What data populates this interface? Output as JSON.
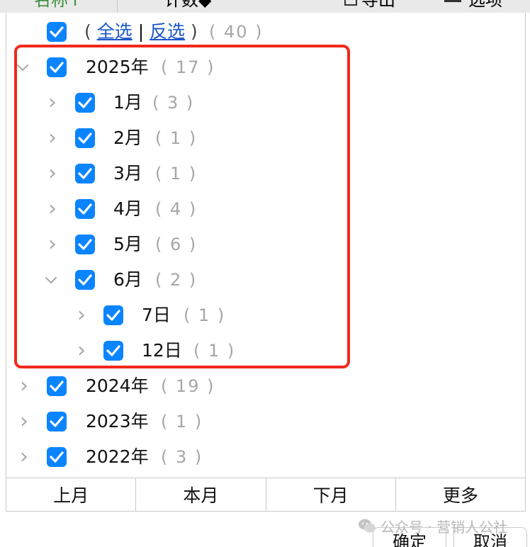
{
  "header": {
    "col_name": "名称↑",
    "col_count": "计数◆",
    "export": "导出",
    "options": "选项"
  },
  "tree": {
    "select_all_open": "(",
    "select_all": "全选",
    "divider": "|",
    "invert": "反选",
    "select_all_close": ")",
    "total_count": "( 40 )",
    "year_2025": {
      "label": "2025年",
      "count": "( 17 )"
    },
    "months": [
      {
        "label": "1月",
        "count": "( 3 )"
      },
      {
        "label": "2月",
        "count": "( 1 )"
      },
      {
        "label": "3月",
        "count": "( 1 )"
      },
      {
        "label": "4月",
        "count": "( 4 )"
      },
      {
        "label": "5月",
        "count": "( 6 )"
      },
      {
        "label": "6月",
        "count": "( 2 )"
      }
    ],
    "days": [
      {
        "label": "7日",
        "count": "( 1 )"
      },
      {
        "label": "12日",
        "count": "( 1 )"
      }
    ],
    "year_2024": {
      "label": "2024年",
      "count": "( 19 )"
    },
    "year_2023": {
      "label": "2023年",
      "count": "( 1 )"
    },
    "year_2022": {
      "label": "2022年",
      "count": "( 3 )"
    }
  },
  "buttons": {
    "last_month": "上月",
    "this_month": "本月",
    "next_month": "下月",
    "more": "更多"
  },
  "footer": {
    "ok": "确定",
    "cancel": "取消"
  },
  "watermark": "公众号 · 营销人公社",
  "colors": {
    "checkbox": "#0a84ff",
    "highlight": "#f1291c",
    "link": "#1a56c9",
    "count_text": "#a6a6a6"
  }
}
